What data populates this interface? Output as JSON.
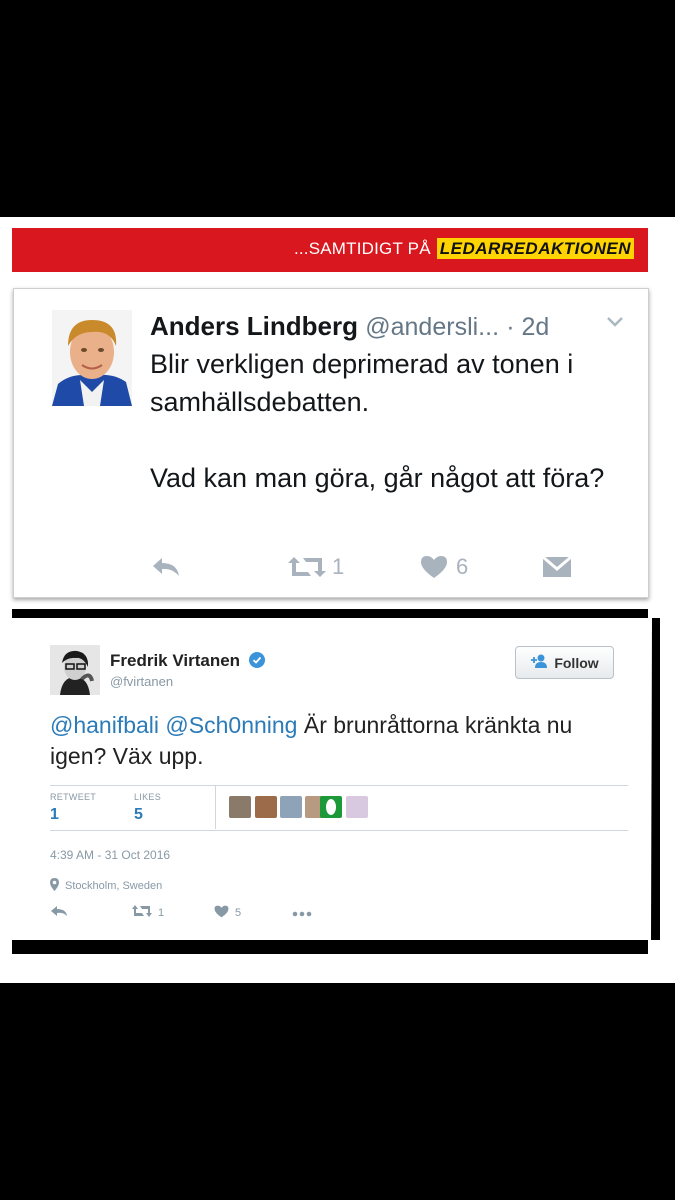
{
  "banner": {
    "prefix": "...SAMTIDIGT PÅ",
    "brand": "LEDARREDAKTIONEN",
    "color": "#d8171e",
    "brand_color": "#ffd400"
  },
  "tweet1": {
    "name": "Anders Lindberg",
    "handle": "@andersli...",
    "time": "· 2d",
    "text_line1": "Blir verkligen deprimerad av tonen i samhällsdebatten.",
    "text_line2": "Vad kan man göra, går något att föra?",
    "retweets": "1",
    "likes": "6",
    "icons": [
      "reply-icon",
      "retweet-icon",
      "heart-icon",
      "dm-icon",
      "chevron-down-icon"
    ]
  },
  "tweet2": {
    "name": "Fredrik Virtanen",
    "handle": "@fvirtanen",
    "follow_label": "Follow",
    "mention1": "@hanifbali",
    "mention2": "@Sch0nning",
    "text": " Är brunråttorna kränkta nu igen? Väx upp.",
    "retweet_label": "RETWEET",
    "retweet_count": "1",
    "likes_label": "LIKES",
    "likes_count": "5",
    "timestamp": "4:39 AM - 31 Oct 2016",
    "location": "Stockholm, Sweden",
    "action_retweets": "1",
    "action_likes": "5",
    "link_color": "#2b7bb9",
    "icons": [
      "verified-icon",
      "follow-person-icon",
      "location-pin-icon",
      "reply-icon",
      "retweet-icon",
      "heart-icon",
      "more-icon"
    ]
  }
}
